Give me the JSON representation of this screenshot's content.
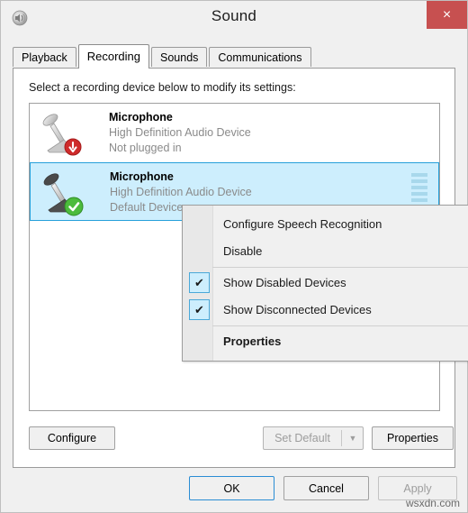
{
  "window": {
    "title": "Sound",
    "icon": "speaker-icon",
    "close_label": "×"
  },
  "tabs": [
    {
      "label": "Playback",
      "active": false
    },
    {
      "label": "Recording",
      "active": true
    },
    {
      "label": "Sounds",
      "active": false
    },
    {
      "label": "Communications",
      "active": false
    }
  ],
  "panel": {
    "instruction": "Select a recording device below to modify its settings:"
  },
  "devices": [
    {
      "name": "Microphone",
      "description": "High Definition Audio Device",
      "status": "Not plugged in",
      "badge": "unplugged-badge",
      "selected": false,
      "has_meter": false
    },
    {
      "name": "Microphone",
      "description": "High Definition Audio Device",
      "status": "Default Device",
      "badge": "default-check-badge",
      "selected": true,
      "has_meter": true,
      "meter_segments": 6
    }
  ],
  "list_buttons": {
    "configure": "Configure",
    "set_default": "Set Default",
    "set_default_arrow": "▼",
    "properties": "Properties"
  },
  "dialog_buttons": {
    "ok": "OK",
    "cancel": "Cancel",
    "apply": "Apply"
  },
  "context_menu": {
    "items": [
      {
        "label": "Configure Speech Recognition",
        "checked": false,
        "bold": false
      },
      {
        "label": "Disable",
        "checked": false,
        "bold": false
      },
      {
        "label": "Show Disabled Devices",
        "checked": true,
        "bold": false
      },
      {
        "label": "Show Disconnected Devices",
        "checked": true,
        "bold": false
      },
      {
        "label": "Properties",
        "checked": false,
        "bold": true
      }
    ],
    "check_glyph": "✔"
  },
  "watermark": "wsxdn.com",
  "colors": {
    "selection_blue": "#cdeefd",
    "selection_border": "#26a0da",
    "close_red": "#c75050",
    "window_bg": "#f0f0f0",
    "focus_border": "#2a8dd4"
  }
}
